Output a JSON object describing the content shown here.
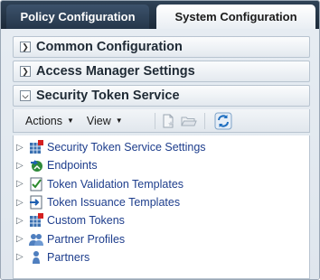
{
  "tabs": {
    "policy": "Policy Configuration",
    "system": "System Configuration"
  },
  "sections": {
    "common": "Common Configuration",
    "access_manager": "Access Manager Settings",
    "sts": "Security Token Service"
  },
  "toolbar": {
    "actions": "Actions",
    "view": "View"
  },
  "tree": [
    {
      "label": "Security Token Service Settings",
      "icon": "grid-settings-icon"
    },
    {
      "label": "Endpoints",
      "icon": "endpoints-icon"
    },
    {
      "label": "Token Validation Templates",
      "icon": "validation-template-icon"
    },
    {
      "label": "Token Issuance Templates",
      "icon": "issuance-template-icon"
    },
    {
      "label": "Custom Tokens",
      "icon": "custom-tokens-icon"
    },
    {
      "label": "Partner Profiles",
      "icon": "partner-profiles-icon"
    },
    {
      "label": "Partners",
      "icon": "partners-icon"
    }
  ],
  "colors": {
    "tabbar": "#1c2a39",
    "link": "#1d3d8c"
  }
}
